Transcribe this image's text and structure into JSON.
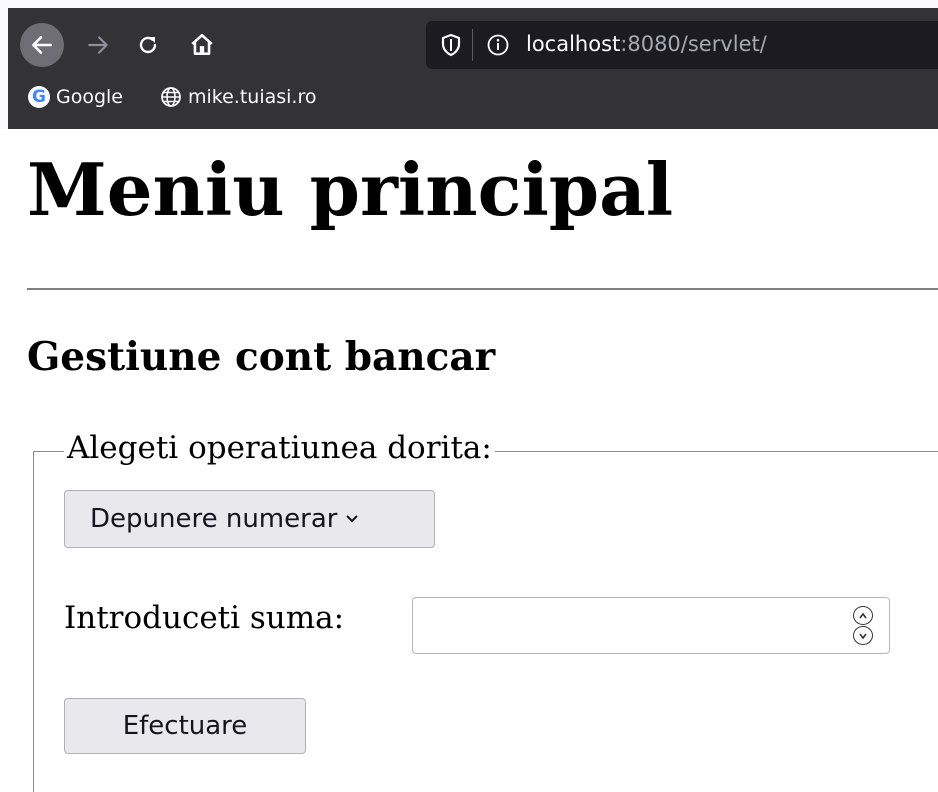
{
  "browser": {
    "url_host": "localhost",
    "url_path": ":8080/servlet/",
    "bookmarks": [
      {
        "label": "Google",
        "icon": "google-icon"
      },
      {
        "label": "mike.tuiasi.ro",
        "icon": "globe-icon"
      }
    ],
    "icons": {
      "back": "back-arrow-icon",
      "forward": "forward-arrow-icon",
      "reload": "reload-icon",
      "home": "home-icon",
      "shield": "shield-icon",
      "info": "info-icon"
    },
    "colors": {
      "toolbar_bg": "#333336",
      "urlbar_bg": "#1c1b22"
    }
  },
  "page": {
    "title": "Meniu principal",
    "section_title": "Gestiune cont bancar",
    "form": {
      "legend": "Alegeti operatiunea dorita:",
      "operation_selected": "Depunere numerar",
      "amount_label": "Introduceti suma:",
      "amount_value": "",
      "submit_label": "Efectuare"
    }
  }
}
